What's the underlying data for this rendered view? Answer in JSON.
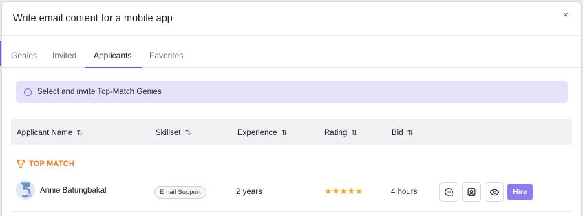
{
  "modal": {
    "title": "Write email content for a mobile app",
    "close_label": "×"
  },
  "tabs": [
    {
      "label": "Genies"
    },
    {
      "label": "Invited"
    },
    {
      "label": "Applicants",
      "active": true
    },
    {
      "label": "Favorites"
    }
  ],
  "banner": {
    "icon": "info-icon",
    "text": "Select and invite Top-Match Genies"
  },
  "table": {
    "columns": [
      {
        "label": "Applicant Name",
        "sort_icon": "⇅"
      },
      {
        "label": "Skillset",
        "sort_icon": "⇅"
      },
      {
        "label": "Experience",
        "sort_icon": "⇅"
      },
      {
        "label": "Rating",
        "sort_icon": "⇅"
      },
      {
        "label": "Bid",
        "sort_icon": "⇅"
      }
    ],
    "section_label": "TOP MATCH",
    "rows": [
      {
        "name": "Annie Batungbakal",
        "skill": "Email Support",
        "experience": "2 years",
        "rating": 5,
        "rating_stars": "★★★★★",
        "bid": "4 hours",
        "actions": [
          "chat-icon",
          "profile-card-icon",
          "eye-icon"
        ],
        "hire_label": "Hire"
      }
    ]
  },
  "colors": {
    "accent": "#5b5bd6",
    "banner_bg": "#e6e1fb",
    "top_match": "#f07c1c",
    "star": "#f5a623",
    "hire_bg": "#8b7cf0"
  }
}
